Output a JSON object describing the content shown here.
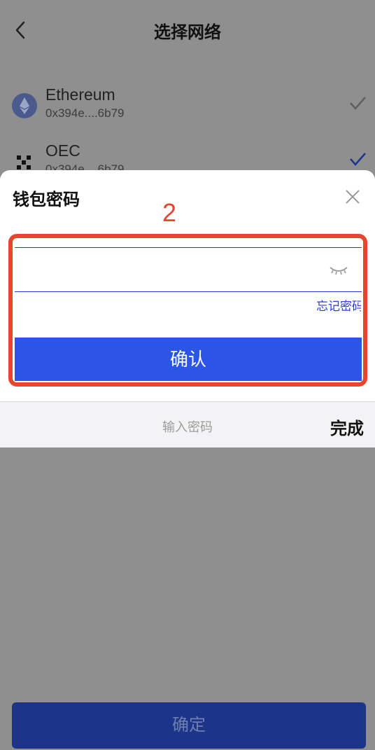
{
  "header": {
    "title": "选择网络"
  },
  "networks": [
    {
      "name": "Ethereum",
      "address": "0x394e....6b79",
      "selected": false
    },
    {
      "name": "OEC",
      "address": "0x394e....6b79",
      "selected": true
    }
  ],
  "modal": {
    "title": "钱包密码",
    "step_number": "2",
    "password_value": "",
    "forgot_label": "忘记密码",
    "confirm_label": "确认"
  },
  "keyboard": {
    "placeholder": "输入密码",
    "done_label": "完成"
  },
  "bottom": {
    "confirm_label": "确定"
  },
  "colors": {
    "accent": "#2a55e6",
    "highlight": "#e8452e",
    "overlay": "#8f8f8f"
  }
}
